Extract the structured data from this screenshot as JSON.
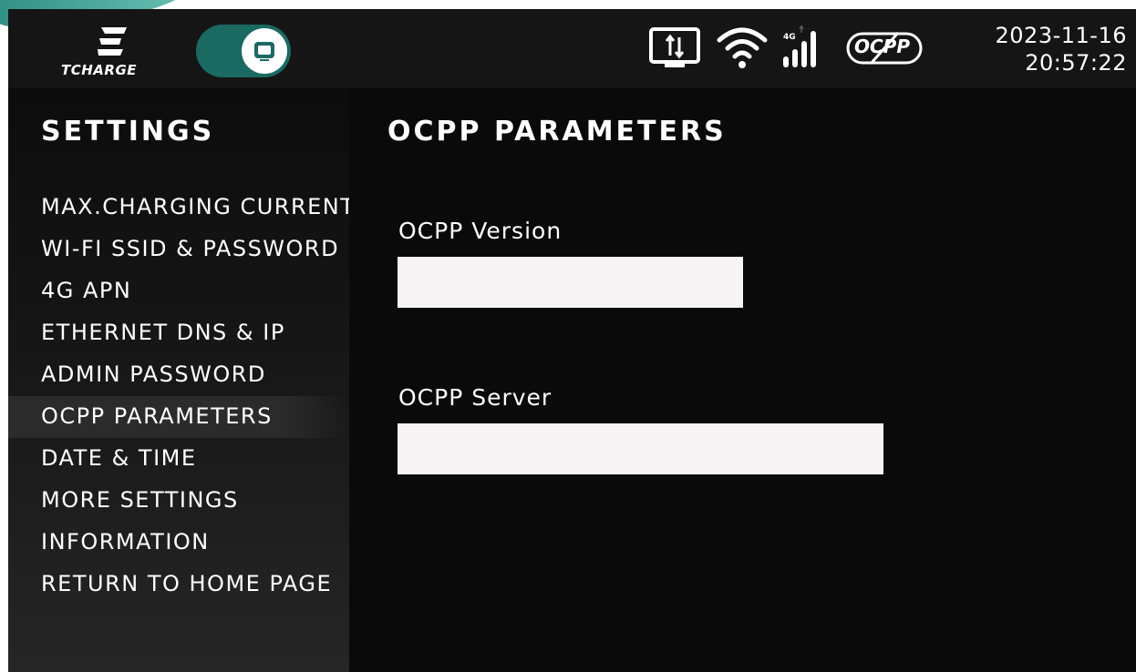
{
  "brand": {
    "name": "TCHARGE"
  },
  "header": {
    "toggle_icon": "screen-icon",
    "status_icons": [
      "transfer-icon",
      "wifi-icon",
      "4g-signal-icon",
      "ocpp-disconnected-icon"
    ],
    "network_label": "4G",
    "ocpp_label": "OCPP",
    "date": "2023-11-16",
    "time": "20:57:22"
  },
  "sidebar": {
    "title": "SETTINGS",
    "items": [
      {
        "label": "MAX.CHARGING CURRENT"
      },
      {
        "label": "WI-FI SSID & PASSWORD"
      },
      {
        "label": "4G APN"
      },
      {
        "label": "ETHERNET DNS & IP"
      },
      {
        "label": "ADMIN PASSWORD"
      },
      {
        "label": "OCPP PARAMETERS",
        "active": true
      },
      {
        "label": "DATE & TIME"
      },
      {
        "label": "MORE SETTINGS"
      },
      {
        "label": "INFORMATION"
      },
      {
        "label": "RETURN TO HOME PAGE"
      }
    ]
  },
  "main": {
    "title": "OCPP PARAMETERS",
    "fields": [
      {
        "label": "OCPP Version",
        "value": ""
      },
      {
        "label": "OCPP Server",
        "value": ""
      }
    ]
  },
  "colors": {
    "accent": "#1a6a62",
    "background": "#101010",
    "input_bg": "#f8f4f6",
    "text": "#ffffff"
  }
}
